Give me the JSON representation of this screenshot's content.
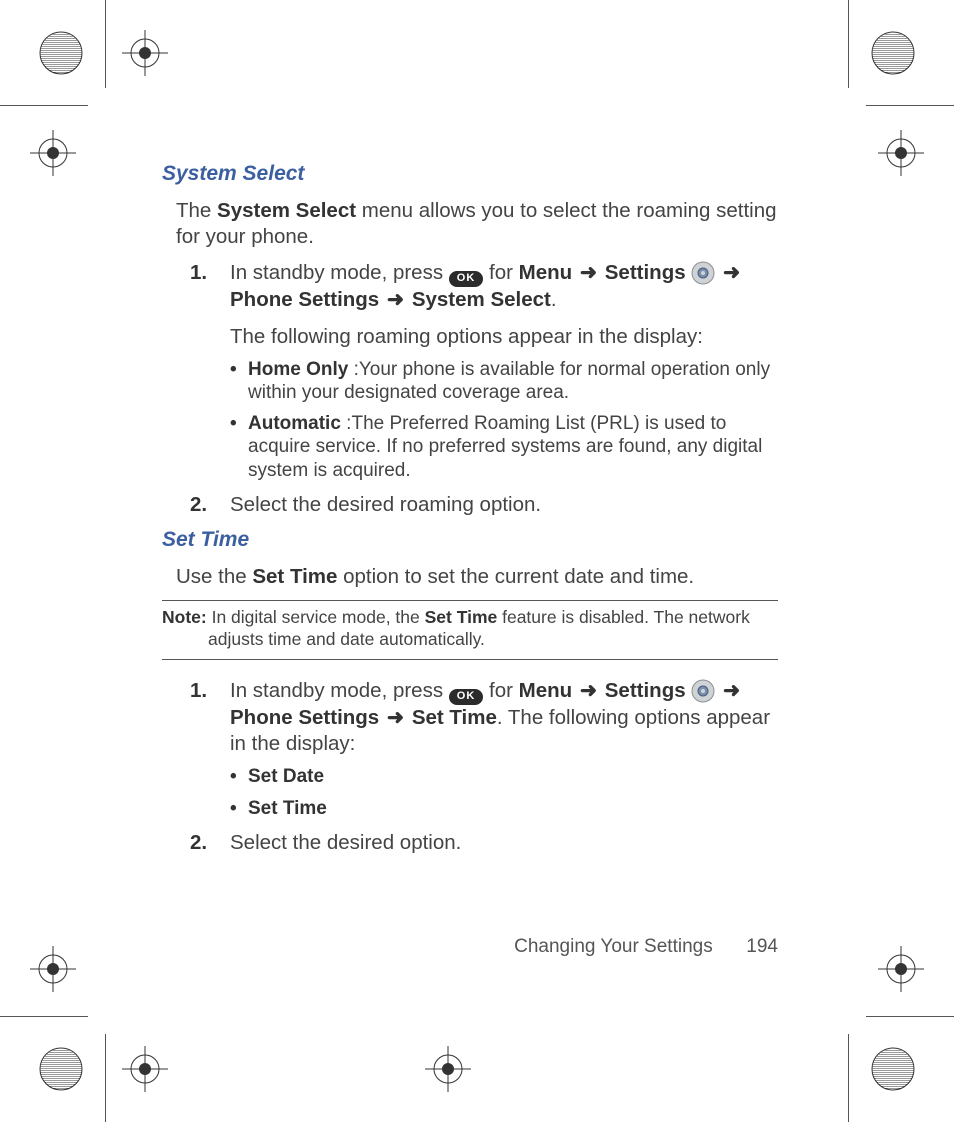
{
  "section1": {
    "heading": "System Select",
    "intro_pre": "The ",
    "intro_bold": "System Select",
    "intro_post": " menu allows you to select the roaming setting for your phone.",
    "step1": {
      "num": "1.",
      "line1_pre": "In standby mode, press ",
      "ok": "OK",
      "line1_for": " for ",
      "menu": "Menu",
      "arrow": "➜",
      "settings": "Settings",
      "phone_settings": "Phone Settings",
      "system_select": "System Select",
      "period": ".",
      "sub": "The following roaming options appear in the display:",
      "bullets": [
        {
          "term": "Home Only",
          "desc": " :Your phone is available for normal operation only within your designated coverage area."
        },
        {
          "term": "Automatic",
          "desc": " :The Preferred Roaming List (PRL) is used to acquire service. If no preferred systems are found, any digital system is acquired."
        }
      ]
    },
    "step2": {
      "num": "2.",
      "text": "Select the desired roaming option."
    }
  },
  "section2": {
    "heading": "Set Time",
    "intro_pre": "Use the ",
    "intro_bold": "Set Time",
    "intro_post": " option to set the current date and time.",
    "note_label": "Note:",
    "note_pre": " In digital service mode, the ",
    "note_bold": "Set Time",
    "note_post": " feature is disabled. The network adjusts time and date automatically.",
    "step1": {
      "num": "1.",
      "line1_pre": "In standby mode, press ",
      "ok": "OK",
      "line1_for": " for ",
      "menu": "Menu",
      "arrow": "➜",
      "settings": "Settings",
      "phone_settings": "Phone Settings",
      "set_time": "Set Time",
      "tail": ". The following options appear in the display:",
      "bullets": [
        "Set Date",
        "Set Time"
      ]
    },
    "step2": {
      "num": "2.",
      "text": "Select the desired option."
    }
  },
  "footer": {
    "chapter": "Changing Your Settings",
    "page": "194"
  }
}
